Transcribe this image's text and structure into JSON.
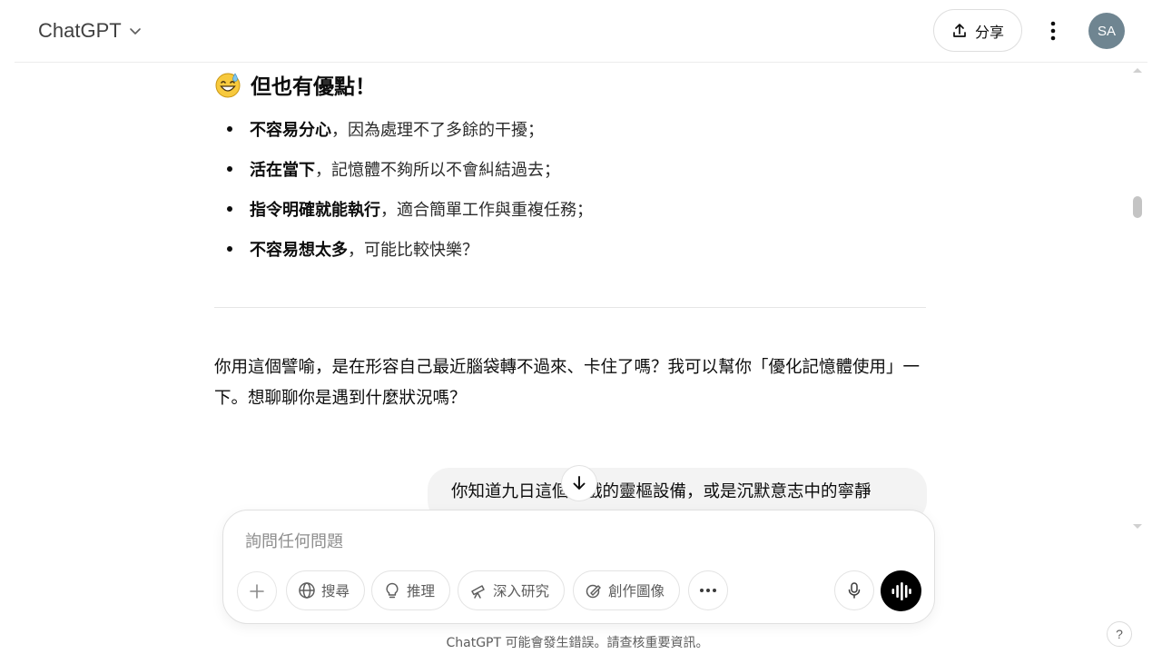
{
  "header": {
    "model_name": "ChatGPT",
    "share_label": "分享",
    "avatar_initials": "SA"
  },
  "response": {
    "heading": "但也有優點！",
    "heading_emoji": "grinning-sweat-face-icon",
    "bullets": [
      {
        "bold": "不容易分心",
        "text": "，因為處理不了多餘的干擾；"
      },
      {
        "bold": "活在當下",
        "text": "，記憶體不夠所以不會糾結過去；"
      },
      {
        "bold": "指令明確就能執行",
        "text": "，適合簡單工作與重複任務；"
      },
      {
        "bold": "不容易想太多",
        "text": "，可能比較快樂？"
      }
    ],
    "paragraph": "你用這個譬喻，是在形容自己最近腦袋轉不過來、卡住了嗎？我可以幫你「優化記憶體使用」一下。想聊聊你是遇到什麼狀況嗎？"
  },
  "user_message": {
    "text": "你知道九日這個遊戲的靈樞設備，或是沉默意志中的寧靜"
  },
  "composer": {
    "placeholder": "詢問任何問題",
    "tools": [
      {
        "label": "搜尋",
        "icon": "globe-icon"
      },
      {
        "label": "推理",
        "icon": "lightbulb-icon"
      },
      {
        "label": "深入研究",
        "icon": "telescope-icon"
      },
      {
        "label": "創作圖像",
        "icon": "image-create-icon"
      }
    ]
  },
  "footer": {
    "disclaimer": "ChatGPT 可能會發生錯誤。請查核重要資訊。",
    "help_label": "?"
  },
  "colors": {
    "avatar_bg": "#6f8591",
    "voice_button_bg": "#000000",
    "user_bubble_bg": "#f3f3f3"
  }
}
